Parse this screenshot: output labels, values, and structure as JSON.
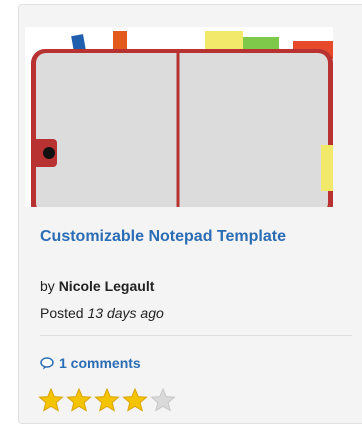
{
  "card": {
    "title": "Customizable Notepad Template",
    "byline_prefix": "by",
    "author": "Nicole Legault",
    "posted_prefix": "Posted",
    "posted_age": "13 days ago",
    "comments_label": "1 comments",
    "rating": 4,
    "rating_max": 5,
    "colors": {
      "link": "#2a6db5",
      "star_filled": "#f5c400",
      "star_empty": "#d9d9d9",
      "notebook_border": "#b83232"
    }
  }
}
